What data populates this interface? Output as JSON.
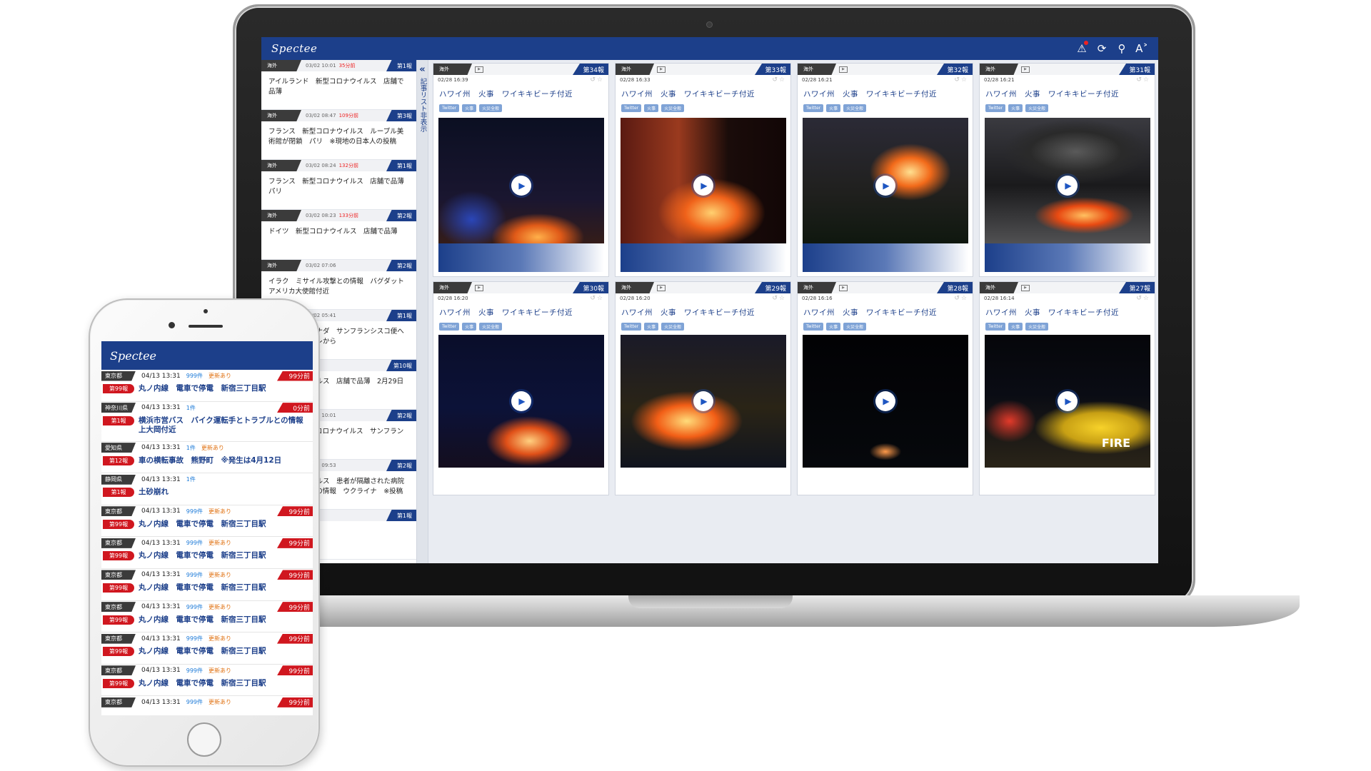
{
  "desktop": {
    "brand": "Spectee",
    "sidebar_toggle_chevron": "«",
    "sidebar_toggle_label": "記事リスト非表示",
    "article_list": [
      {
        "region": "海外",
        "time": "03/02 10:01",
        "ago": "35分前",
        "report": "第1報",
        "title": "アイルランド　新型コロナウイルス　店舗で品薄"
      },
      {
        "region": "海外",
        "time": "03/02 08:47",
        "ago": "109分前",
        "report": "第3報",
        "title": "フランス　新型コロナウイルス　ルーブル美術館が閉鎖　パリ　※現地の日本人の投稿"
      },
      {
        "region": "海外",
        "time": "03/02 08:24",
        "ago": "132分前",
        "report": "第1報",
        "title": "フランス　新型コロナウイルス　店舗で品薄　パリ"
      },
      {
        "region": "海外",
        "time": "03/02 08:23",
        "ago": "133分前",
        "report": "第2報",
        "title": "ドイツ　新型コロナウイルス　店舗で品薄"
      },
      {
        "region": "海外",
        "time": "03/02 07:06",
        "ago": "",
        "report": "第2報",
        "title": "イラク　ミサイル攻撃との情報　バグダット　アメリカ大使館付近"
      },
      {
        "region": "海外",
        "time": "03/02 05:41",
        "ago": "",
        "report": "第1報",
        "title": "カナダ　エアカナダ　サンフランシスコ便へ引き返す　トイレから"
      },
      {
        "region": "海外",
        "time": "",
        "ago": "",
        "report": "第10報",
        "title": "新型コロナウイルス　店舗で品薄　2月29日"
      },
      {
        "region": "海外",
        "time": "03/02 10:01",
        "ago": "",
        "report": "第2報",
        "title": "アメリカ　新型コロナウイルス　サンフランシスコ"
      },
      {
        "region": "海外",
        "time": "03/01 09:53",
        "ago": "",
        "report": "第2報",
        "title": "新型コロナウイルス　患者が隔離された病院が放火されるとの情報　ウクライナ　※投稿は2月29日"
      },
      {
        "region": "海外",
        "time": "",
        "ago": "",
        "report": "第1報",
        "title": ""
      }
    ],
    "cards": [
      {
        "region": "海外",
        "report": "第34報",
        "time": "02/28 16:39",
        "title": "ハワイ州　火事　ワイキキビーチ付近",
        "tags": [
          "Twitter",
          "火事",
          "火災全般"
        ],
        "image": "fire1",
        "label": ""
      },
      {
        "region": "海外",
        "report": "第33報",
        "time": "02/28 16:33",
        "title": "ハワイ州　火事　ワイキキビーチ付近",
        "tags": [
          "Twitter",
          "火事",
          "火災全般"
        ],
        "image": "fire2",
        "label": ""
      },
      {
        "region": "海外",
        "report": "第32報",
        "time": "02/28 16:21",
        "title": "ハワイ州　火事　ワイキキビーチ付近",
        "tags": [
          "Twitter",
          "火事",
          "火災全般"
        ],
        "image": "fire3",
        "label": ""
      },
      {
        "region": "海外",
        "report": "第31報",
        "time": "02/28 16:21",
        "title": "ハワイ州　火事　ワイキキビーチ付近",
        "tags": [
          "Twitter",
          "火事",
          "火災全般"
        ],
        "image": "fire4",
        "label": ""
      },
      {
        "region": "海外",
        "report": "第30報",
        "time": "02/28 16:20",
        "title": "ハワイ州　火事　ワイキキビーチ付近",
        "tags": [
          "Twitter",
          "火事",
          "火災全般"
        ],
        "image": "fire5",
        "label": ""
      },
      {
        "region": "海外",
        "report": "第29報",
        "time": "02/28 16:20",
        "title": "ハワイ州　火事　ワイキキビーチ付近",
        "tags": [
          "Twitter",
          "火事",
          "火災全般"
        ],
        "image": "fire6",
        "label": ""
      },
      {
        "region": "海外",
        "report": "第28報",
        "time": "02/28 16:16",
        "title": "ハワイ州　火事　ワイキキビーチ付近",
        "tags": [
          "Twitter",
          "火事",
          "火災全般"
        ],
        "image": "fire7",
        "label": ""
      },
      {
        "region": "海外",
        "report": "第27報",
        "time": "02/28 16:14",
        "title": "ハワイ州　火事　ワイキキビーチ付近",
        "tags": [
          "Twitter",
          "火事",
          "火災全般"
        ],
        "image": "fire8",
        "label": "FIRE"
      }
    ]
  },
  "mobile": {
    "brand": "Spectee",
    "items": [
      {
        "region": "東京都",
        "time": "04/13 13:31",
        "count": "999件",
        "updated": "更新あり",
        "ago": "99分前",
        "report": "第99報",
        "title": "丸ノ内線　電車で停電　新宿三丁目駅"
      },
      {
        "region": "神奈川県",
        "time": "04/13 13:31",
        "count": "1件",
        "updated": "",
        "ago": "0分前",
        "report": "第1報",
        "title": "横浜市営バス　バイク運転手とトラブルとの情報　上大岡付近"
      },
      {
        "region": "愛知県",
        "time": "04/13 13:31",
        "count": "1件",
        "updated": "更新あり",
        "ago": "",
        "report": "第12報",
        "title": "車の横転事故　熊野町　※発生は4月12日"
      },
      {
        "region": "静岡県",
        "time": "04/13 13:31",
        "count": "1件",
        "updated": "",
        "ago": "",
        "report": "第1報",
        "title": "土砂崩れ"
      },
      {
        "region": "東京都",
        "time": "04/13 13:31",
        "count": "999件",
        "updated": "更新あり",
        "ago": "99分前",
        "report": "第99報",
        "title": "丸ノ内線　電車で停電　新宿三丁目駅"
      },
      {
        "region": "東京都",
        "time": "04/13 13:31",
        "count": "999件",
        "updated": "更新あり",
        "ago": "99分前",
        "report": "第99報",
        "title": "丸ノ内線　電車で停電　新宿三丁目駅"
      },
      {
        "region": "東京都",
        "time": "04/13 13:31",
        "count": "999件",
        "updated": "更新あり",
        "ago": "99分前",
        "report": "第99報",
        "title": "丸ノ内線　電車で停電　新宿三丁目駅"
      },
      {
        "region": "東京都",
        "time": "04/13 13:31",
        "count": "999件",
        "updated": "更新あり",
        "ago": "99分前",
        "report": "第99報",
        "title": "丸ノ内線　電車で停電　新宿三丁目駅"
      },
      {
        "region": "東京都",
        "time": "04/13 13:31",
        "count": "999件",
        "updated": "更新あり",
        "ago": "99分前",
        "report": "第99報",
        "title": "丸ノ内線　電車で停電　新宿三丁目駅"
      },
      {
        "region": "東京都",
        "time": "04/13 13:31",
        "count": "999件",
        "updated": "更新あり",
        "ago": "99分前",
        "report": "第99報",
        "title": "丸ノ内線　電車で停電　新宿三丁目駅"
      },
      {
        "region": "東京都",
        "time": "04/13 13:31",
        "count": "999件",
        "updated": "更新あり",
        "ago": "99分前",
        "report": "",
        "title": ""
      }
    ]
  },
  "colors": {
    "brand_navy": "#1c3f8a",
    "report_red": "#d0171f",
    "region_dark": "#3b3b3b",
    "link_blue": "#1e7bd8",
    "update_orange": "#e07010"
  }
}
